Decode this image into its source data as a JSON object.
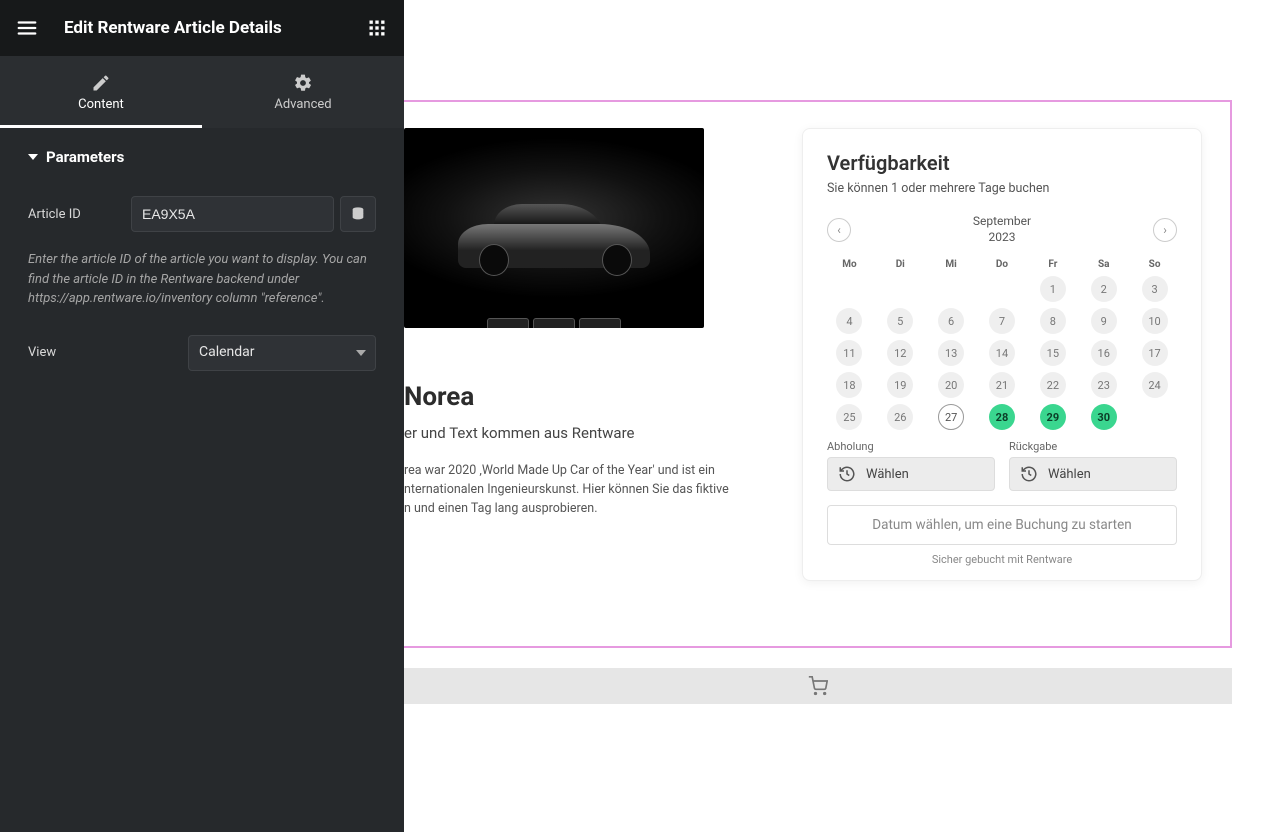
{
  "sidebar": {
    "title": "Edit Rentware Article Details",
    "tabs": {
      "content": "Content",
      "advanced": "Advanced"
    },
    "section": "Parameters",
    "article_id_label": "Article ID",
    "article_id_value": "EA9X5A",
    "help": "Enter the article ID of the article you want to display. You can find the article ID in the Rentware backend under https://app.rentware.io/inventory column \"reference\".",
    "view_label": "View",
    "view_value": "Calendar"
  },
  "product": {
    "title": "Norea",
    "subtitle": "er und Text kommen aus Rentware",
    "desc_l1": "rea war 2020 ‚World Made Up Car of the Year' und ist ein",
    "desc_l2": "nternationalen Ingenieurskunst. Hier können Sie das fiktive",
    "desc_l3": "n und einen Tag lang ausprobieren."
  },
  "avail": {
    "heading": "Verfügbarkeit",
    "sub": "Sie können 1 oder mehrere Tage buchen",
    "month": "September",
    "year": "2023",
    "dow": [
      "Mo",
      "Di",
      "Mi",
      "Do",
      "Fr",
      "Sa",
      "So"
    ],
    "pickup_label": "Abholung",
    "return_label": "Rückgabe",
    "choose": "Wählen",
    "book_cta": "Datum wählen, um eine Buchung zu starten",
    "secure": "Sicher gebucht mit Rentware",
    "grid": [
      [
        "",
        "",
        "",
        "",
        "1",
        "2",
        "3"
      ],
      [
        "4",
        "5",
        "6",
        "7",
        "8",
        "9",
        "10"
      ],
      [
        "11",
        "12",
        "13",
        "14",
        "15",
        "16",
        "17"
      ],
      [
        "18",
        "19",
        "20",
        "21",
        "22",
        "23",
        "24"
      ],
      [
        "25",
        "26",
        "27",
        "28",
        "29",
        "30",
        ""
      ]
    ],
    "today": "27",
    "available": [
      "28",
      "29",
      "30"
    ]
  }
}
